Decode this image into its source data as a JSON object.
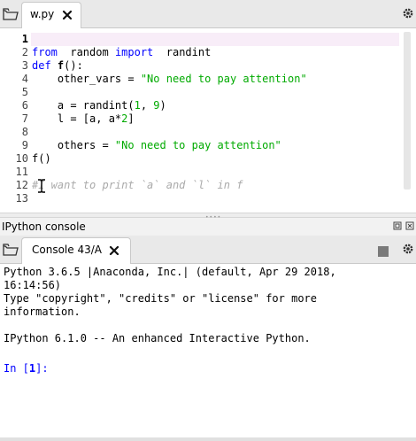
{
  "editor": {
    "tab_label": "w.py",
    "lines": [
      {
        "n": "1",
        "active": true
      },
      {
        "n": "2",
        "parts": [
          [
            "kw",
            "from"
          ],
          [
            "",
            "  random "
          ],
          [
            "kw",
            "import"
          ],
          [
            "",
            "  randint"
          ]
        ]
      },
      {
        "n": "3",
        "parts": [
          [
            "kw",
            "def"
          ],
          [
            "",
            " "
          ],
          [
            "fn",
            "f"
          ],
          [
            "",
            "():"
          ]
        ]
      },
      {
        "n": "4",
        "parts": [
          [
            "",
            "    other_vars = "
          ],
          [
            "str",
            "\"No need to pay attention\""
          ]
        ]
      },
      {
        "n": "5"
      },
      {
        "n": "6",
        "parts": [
          [
            "",
            "    a = randint("
          ],
          [
            "num",
            "1"
          ],
          [
            "",
            ", "
          ],
          [
            "num",
            "9"
          ],
          [
            "",
            ")"
          ]
        ]
      },
      {
        "n": "7",
        "parts": [
          [
            "",
            "    l = [a, a*"
          ],
          [
            "num",
            "2"
          ],
          [
            "",
            "]"
          ]
        ]
      },
      {
        "n": "8"
      },
      {
        "n": "9",
        "parts": [
          [
            "",
            "    others = "
          ],
          [
            "str",
            "\"No need to pay attention\""
          ]
        ]
      },
      {
        "n": "10",
        "parts": [
          [
            "",
            "f()"
          ]
        ]
      },
      {
        "n": "11"
      },
      {
        "n": "12",
        "parts": [
          [
            "cmt",
            "#I want to print `a` and `l` in f"
          ]
        ]
      },
      {
        "n": "13"
      }
    ]
  },
  "ipython": {
    "pane_title": "IPython console",
    "console_tab_label": "Console 43/A",
    "output": [
      "Python 3.6.5 |Anaconda, Inc.| (default, Apr 29 2018,",
      "16:14:56)",
      "Type \"copyright\", \"credits\" or \"license\" for more",
      "information.",
      "",
      "IPython 6.1.0 -- An enhanced Interactive Python.",
      ""
    ],
    "prompt_prefix": "In [",
    "prompt_number": "1",
    "prompt_suffix": "]:"
  },
  "icons": {
    "editor_browse": "folder-icon",
    "editor_close": "close-icon",
    "editor_options": "gear-icon",
    "console_stop": "stop-icon",
    "console_options": "gear-icon",
    "undock": "undock-icon",
    "pane_close": "close-icon"
  }
}
